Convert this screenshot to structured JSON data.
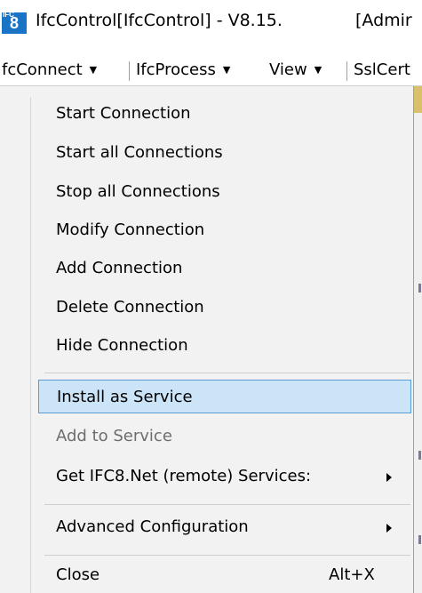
{
  "window": {
    "title": "IfcControl[IfcControl] - V8.15.",
    "title_suffix": "[Admir",
    "icon": "ifc8-app-icon",
    "icon_text": "8",
    "icon_small_text": "IFC"
  },
  "menubar": {
    "items": [
      {
        "label": "fcConnect"
      },
      {
        "label": "IfcProcess"
      },
      {
        "label": "View"
      },
      {
        "label": "SslCert"
      }
    ]
  },
  "dropdown": {
    "items": [
      {
        "label": "Start Connection"
      },
      {
        "label": "Start all Connections"
      },
      {
        "label": "Stop all Connections"
      },
      {
        "label": "Modify Connection"
      },
      {
        "label": "Add Connection"
      },
      {
        "label": "Delete Connection"
      },
      {
        "label": "Hide Connection"
      },
      {
        "label": "Install as Service",
        "state": "highlighted"
      },
      {
        "label": "Add to Service",
        "state": "disabled"
      },
      {
        "label": "Get IFC8.Net (remote) Services:",
        "submenu": true
      },
      {
        "label": "Advanced Configuration",
        "submenu": true
      },
      {
        "label": "Close",
        "shortcut": "Alt+X"
      }
    ]
  },
  "colors": {
    "highlight_bg": "#cce4f7",
    "highlight_border": "#5b9bd5",
    "menu_bg": "#f2f2f2",
    "disabled_text": "#6d6d6d",
    "icon_blue": "#1a74c6"
  }
}
